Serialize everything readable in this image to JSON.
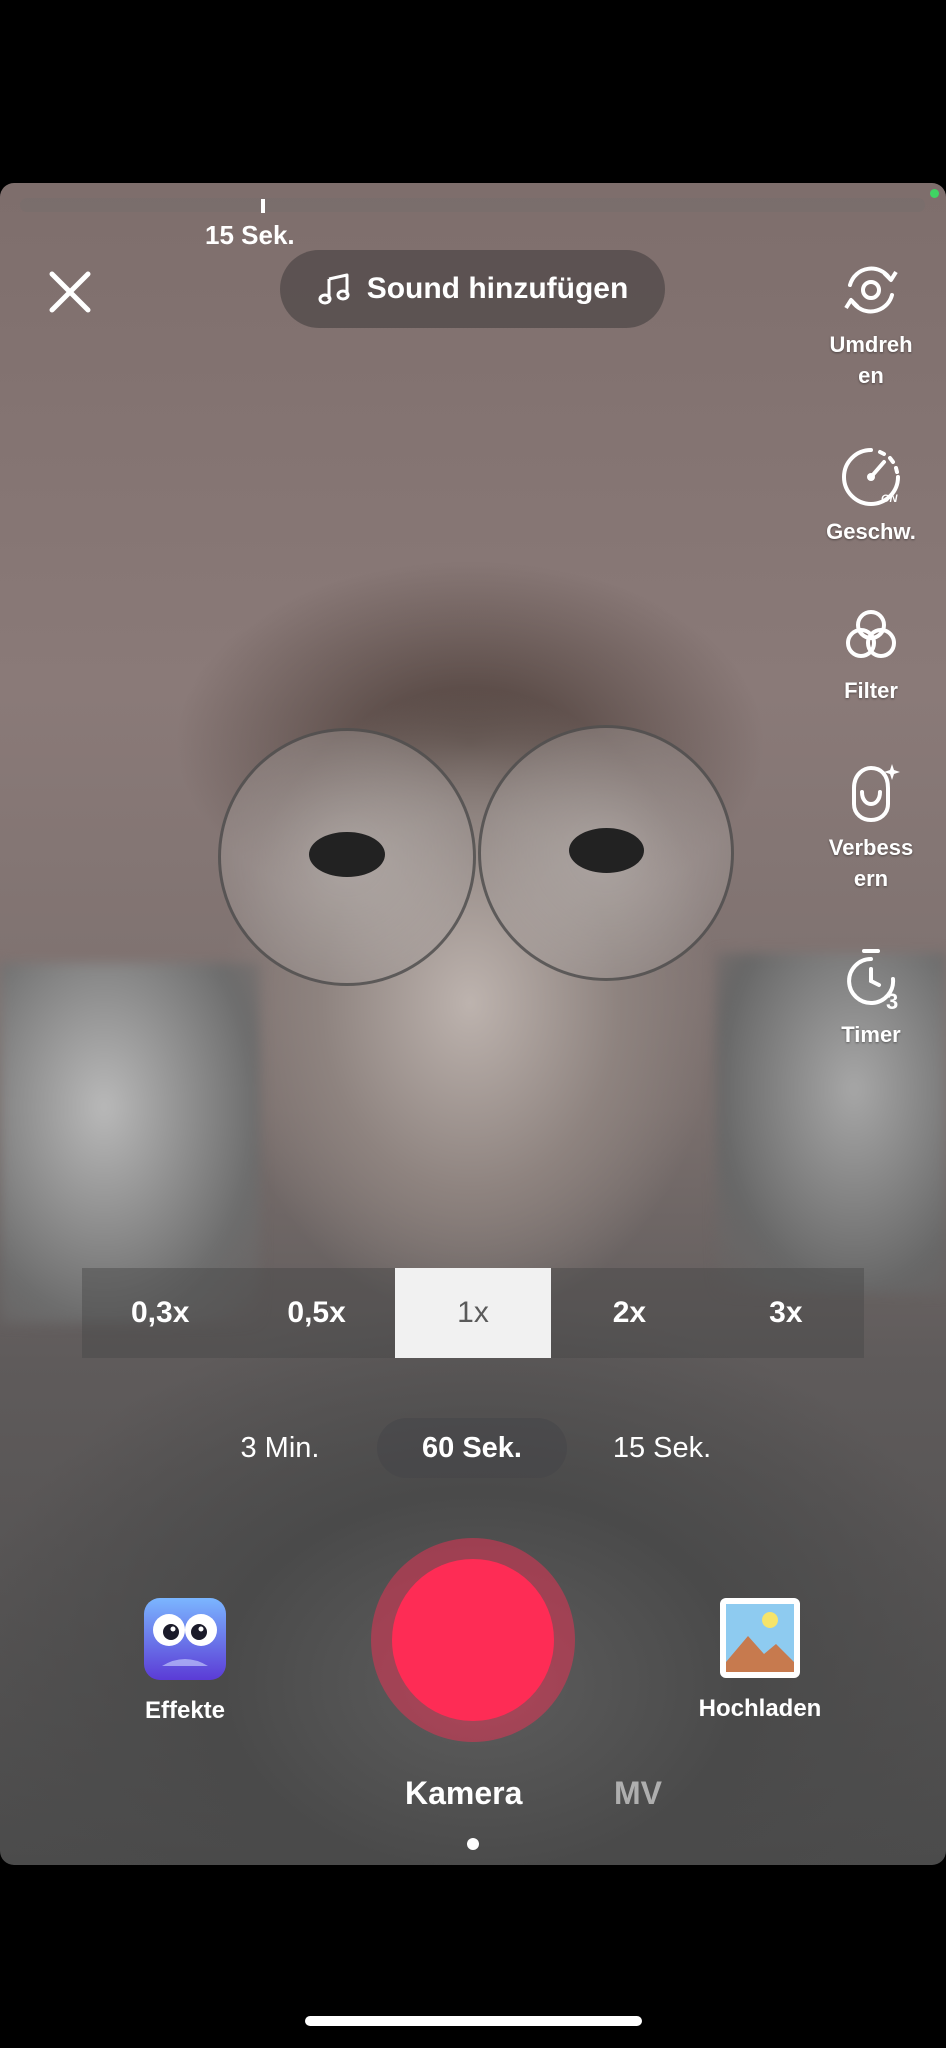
{
  "progress": {
    "label": "15 Sek.",
    "position_fraction": 0.266
  },
  "top": {
    "sound_label": "Sound hinzufügen"
  },
  "side_tools": [
    {
      "label": "Umdreh\nen",
      "icon": "flip-camera-icon"
    },
    {
      "label": "Geschw.",
      "icon": "speed-icon",
      "badge": "ON"
    },
    {
      "label": "Filter",
      "icon": "filter-icon"
    },
    {
      "label": "Verbess\nern",
      "icon": "beautify-icon"
    },
    {
      "label": "Timer",
      "icon": "timer-icon",
      "badge": "3"
    }
  ],
  "zoom": {
    "options": [
      "0,3x",
      "0,5x",
      "1x",
      "2x",
      "3x"
    ],
    "selected": "1x"
  },
  "durations": {
    "options": [
      "3 Min.",
      "60 Sek.",
      "15 Sek."
    ],
    "selected": "60 Sek."
  },
  "bottom": {
    "effects_label": "Effekte",
    "upload_label": "Hochladen"
  },
  "modes": {
    "options": [
      "Kamera",
      "MV"
    ],
    "selected": "Kamera"
  },
  "colors": {
    "record": "#fe2c55",
    "progress_dot": "#3fd463"
  }
}
